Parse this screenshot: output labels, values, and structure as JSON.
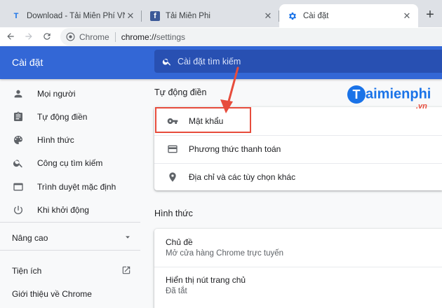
{
  "browser": {
    "tabs": [
      {
        "title": "Download - Tải Miễn Phí VN - Ph",
        "favicon": "T"
      },
      {
        "title": "Tải Miễn Phi",
        "favicon": "f"
      },
      {
        "title": "Cài đặt",
        "favicon": "gear-icon"
      }
    ],
    "new_tab_label": "+",
    "omnibox": {
      "site_label": "Chrome",
      "url_scheme": "chrome://",
      "url_path": "settings"
    }
  },
  "settings": {
    "header_title": "Cài đặt",
    "search_placeholder": "Cài đặt tìm kiếm",
    "colors": {
      "header": "#3367d6",
      "search": "#2850b2",
      "annotation": "#e74c3c",
      "logo": "#1a73e8"
    }
  },
  "sidebar": {
    "items": [
      {
        "label": "Mọi người",
        "icon": "person-icon"
      },
      {
        "label": "Tự động điền",
        "icon": "clipboard-icon"
      },
      {
        "label": "Hình thức",
        "icon": "palette-icon"
      },
      {
        "label": "Công cụ tìm kiếm",
        "icon": "search-icon"
      },
      {
        "label": "Trình duyệt mặc định",
        "icon": "browser-icon"
      },
      {
        "label": "Khi khởi động",
        "icon": "power-icon"
      }
    ],
    "advanced_label": "Nâng cao",
    "extensions_label": "Tiện ích",
    "about_label": "Giới thiệu về Chrome"
  },
  "main": {
    "autofill": {
      "title": "Tự động điền",
      "rows": [
        {
          "label": "Mật khẩu",
          "icon": "key-icon"
        },
        {
          "label": "Phương thức thanh toán",
          "icon": "credit-card-icon"
        },
        {
          "label": "Địa chỉ và các tùy chọn khác",
          "icon": "location-pin-icon"
        }
      ]
    },
    "appearance": {
      "title": "Hình thức",
      "rows": [
        {
          "title": "Chủ đề",
          "subtitle": "Mở cửa hàng Chrome trực tuyến"
        },
        {
          "title": "Hiển thị nút trang chủ",
          "subtitle": "Đã tắt"
        }
      ]
    }
  },
  "watermark": {
    "brand": "aimienphi",
    "brand_letter": "T",
    "tld": ".vn"
  }
}
